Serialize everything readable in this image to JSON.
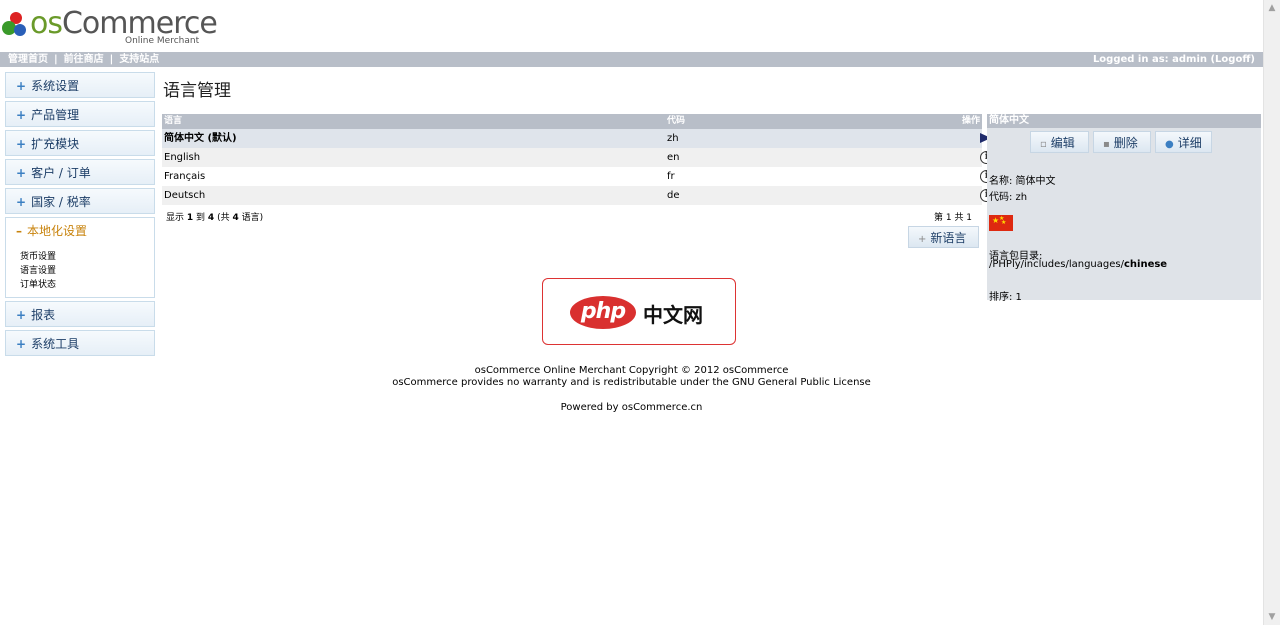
{
  "header": {
    "logo_word_prefix": "os",
    "logo_word_rest": "Commerce",
    "logo_sub": "Online Merchant",
    "nav": [
      "管理首页",
      "前往商店",
      "支持站点"
    ],
    "logged_in": "Logged in as: admin (Logoff)"
  },
  "sidebar": {
    "items_top": [
      {
        "label": "系统设置"
      },
      {
        "label": "产品管理"
      },
      {
        "label": "扩充模块"
      },
      {
        "label": "客户 / 订单"
      },
      {
        "label": "国家 / 税率"
      }
    ],
    "open": {
      "label": "本地化设置",
      "links": [
        "货币设置",
        "语言设置",
        "订单状态"
      ]
    },
    "items_bottom": [
      {
        "label": "报表"
      },
      {
        "label": "系统工具"
      }
    ],
    "plus_glyph": "+",
    "minus_glyph": "–"
  },
  "main": {
    "title": "语言管理",
    "table": {
      "headers": {
        "language": "语言",
        "code": "代码",
        "action": "操作"
      },
      "rows": [
        {
          "language": "简体中文 (默认)",
          "code": "zh",
          "action_icon": "arrow-right-icon",
          "selected": true
        },
        {
          "language": "English",
          "code": "en",
          "action_icon": "info-icon"
        },
        {
          "language": "Français",
          "code": "fr",
          "action_icon": "info-icon"
        },
        {
          "language": "Deutsch",
          "code": "de",
          "action_icon": "info-icon"
        }
      ]
    },
    "pagination": {
      "prefix": "显示",
      "from": "1",
      "to_word": "到",
      "to": "4",
      "total_prefix": "(共",
      "total": "4",
      "total_suffix": "语言)",
      "page_text": "第 1 共 1"
    },
    "new_button": "新语言",
    "info_glyph": "i"
  },
  "infobox": {
    "title": "简体中文",
    "buttons": {
      "edit": "编辑",
      "delete": "删除",
      "details": "详细"
    },
    "name_line": "名称: 简体中文",
    "code_line": "代码: zh",
    "dir_label": "语言包目录:",
    "dir_path": "/PHPly/includes/languages/",
    "dir_name": "chinese",
    "sort_line": "排序: 1"
  },
  "promo": {
    "php": "php",
    "cn": "中文网"
  },
  "footer": {
    "line1": "osCommerce Online Merchant Copyright © 2012 osCommerce",
    "line2": "osCommerce provides no warranty and is redistributable under the GNU General Public License",
    "line3": "Powered by osCommerce.cn"
  },
  "colors": {
    "bar": "#b8bec8",
    "menu_text": "#1d3e67",
    "active_menu": "#c8830c",
    "flag_red": "#de2910"
  }
}
